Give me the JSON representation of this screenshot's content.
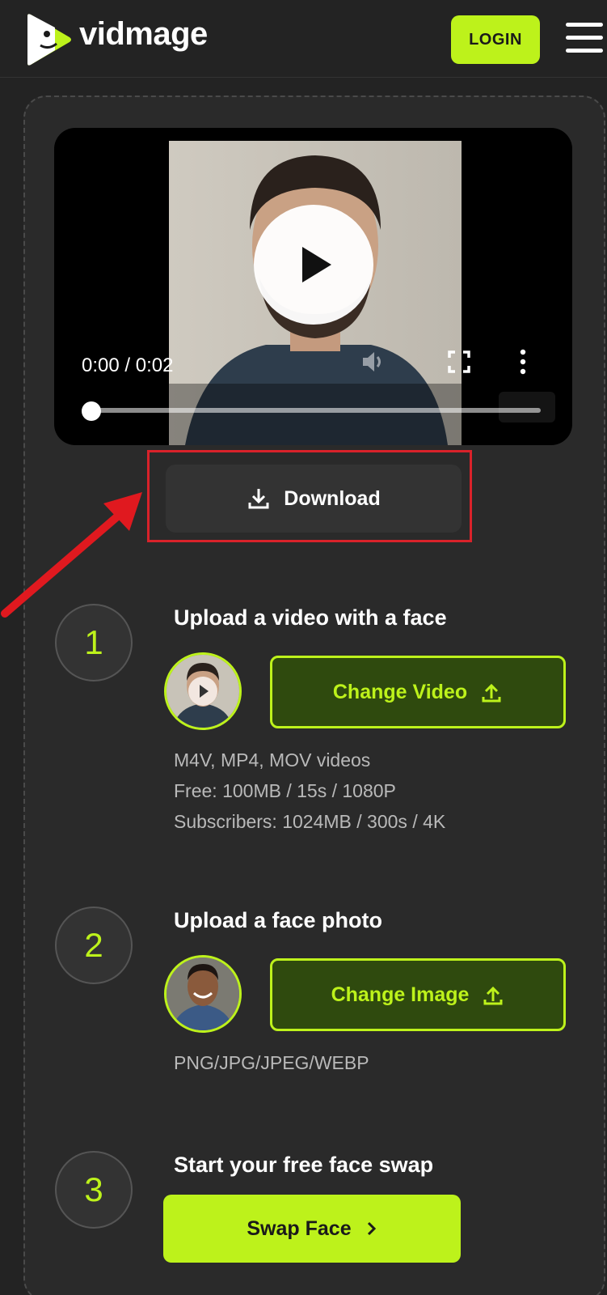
{
  "app": {
    "logo_text": "vidmage",
    "login_label": "LOGIN"
  },
  "player": {
    "time_display": "0:00 / 0:02",
    "progress_fraction": 0.01
  },
  "download": {
    "label": "Download"
  },
  "steps": [
    {
      "number": "1",
      "title": "Upload a video with a face",
      "button_label": "Change Video",
      "info": [
        "M4V, MP4, MOV videos",
        "Free: 100MB / 15s / 1080P",
        "Subscribers: 1024MB / 300s / 4K"
      ]
    },
    {
      "number": "2",
      "title": "Upload a face photo",
      "button_label": "Change Image",
      "info": [
        "PNG/JPG/JPEG/WEBP"
      ]
    },
    {
      "number": "3",
      "title": "Start your free face swap",
      "button_label": "Swap Face"
    }
  ],
  "colors": {
    "accent": "#bdf21b",
    "background": "#232323",
    "card": "#2a2a2a",
    "button_dark_green": "#2f4a0e",
    "annotation_red": "#d9222a"
  },
  "icons": {
    "logo": "vidmage-logo-icon",
    "menu": "hamburger-menu-icon",
    "play": "play-icon",
    "volume": "volume-icon",
    "fullscreen": "fullscreen-icon",
    "more": "more-vertical-icon",
    "download": "download-icon",
    "upload": "upload-icon",
    "chevron": "chevron-right-icon",
    "annotation_arrow": "red-arrow-icon"
  }
}
